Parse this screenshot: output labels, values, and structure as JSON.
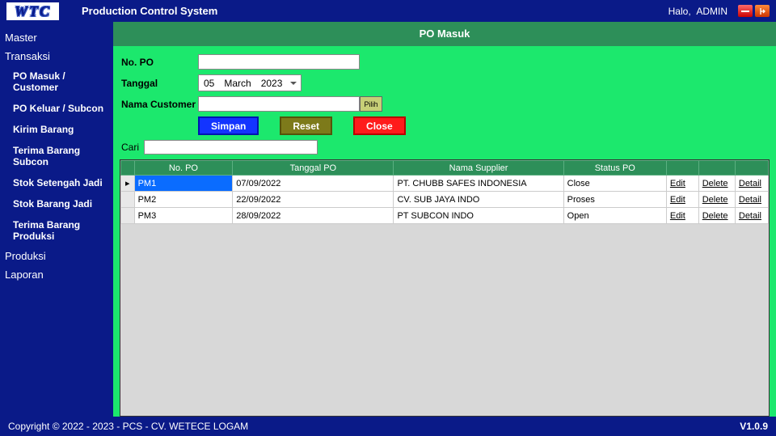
{
  "logo": "WTC",
  "app_title": "Production Control System",
  "greeting_prefix": "Halo,",
  "username": "ADMIN",
  "nav": {
    "master": "Master",
    "transaksi": "Transaksi",
    "items": [
      "PO Masuk / Customer",
      "PO Keluar / Subcon",
      "Kirim Barang",
      "Terima Barang Subcon",
      "Stok Setengah Jadi",
      "Stok Barang Jadi",
      "Terima Barang Produksi"
    ],
    "produksi": "Produksi",
    "laporan": "Laporan"
  },
  "page": {
    "title": "PO Masuk",
    "labels": {
      "no_po": "No. PO",
      "tanggal": "Tanggal",
      "customer": "Nama Customer",
      "pilih": "Pilih",
      "cari": "Cari"
    },
    "date": {
      "day": "05",
      "month": "March",
      "year": "2023"
    },
    "inputs": {
      "no_po": "",
      "customer": "",
      "cari": ""
    },
    "buttons": {
      "simpan": "Simpan",
      "reset": "Reset",
      "close": "Close"
    }
  },
  "grid": {
    "headers": [
      "",
      "No. PO",
      "Tanggal PO",
      "Nama Supplier",
      "Status PO",
      "",
      "",
      ""
    ],
    "links": {
      "edit": "Edit",
      "delete": "Delete",
      "detail": "Detail"
    },
    "rows": [
      {
        "marker": "▸",
        "no_po": "PM1",
        "tanggal": "07/09/2022",
        "supplier": "PT. CHUBB SAFES INDONESIA",
        "status": "Close",
        "selected": true
      },
      {
        "marker": "",
        "no_po": "PM2",
        "tanggal": "22/09/2022",
        "supplier": "CV. SUB JAYA INDO",
        "status": "Proses",
        "selected": false
      },
      {
        "marker": "",
        "no_po": "PM3",
        "tanggal": "28/09/2022",
        "supplier": "PT SUBCON INDO",
        "status": "Open",
        "selected": false
      }
    ]
  },
  "footer": {
    "copyright": "Copyright © 2022 - 2023 - PCS - CV. WETECE LOGAM",
    "version": "V1.0.9"
  }
}
